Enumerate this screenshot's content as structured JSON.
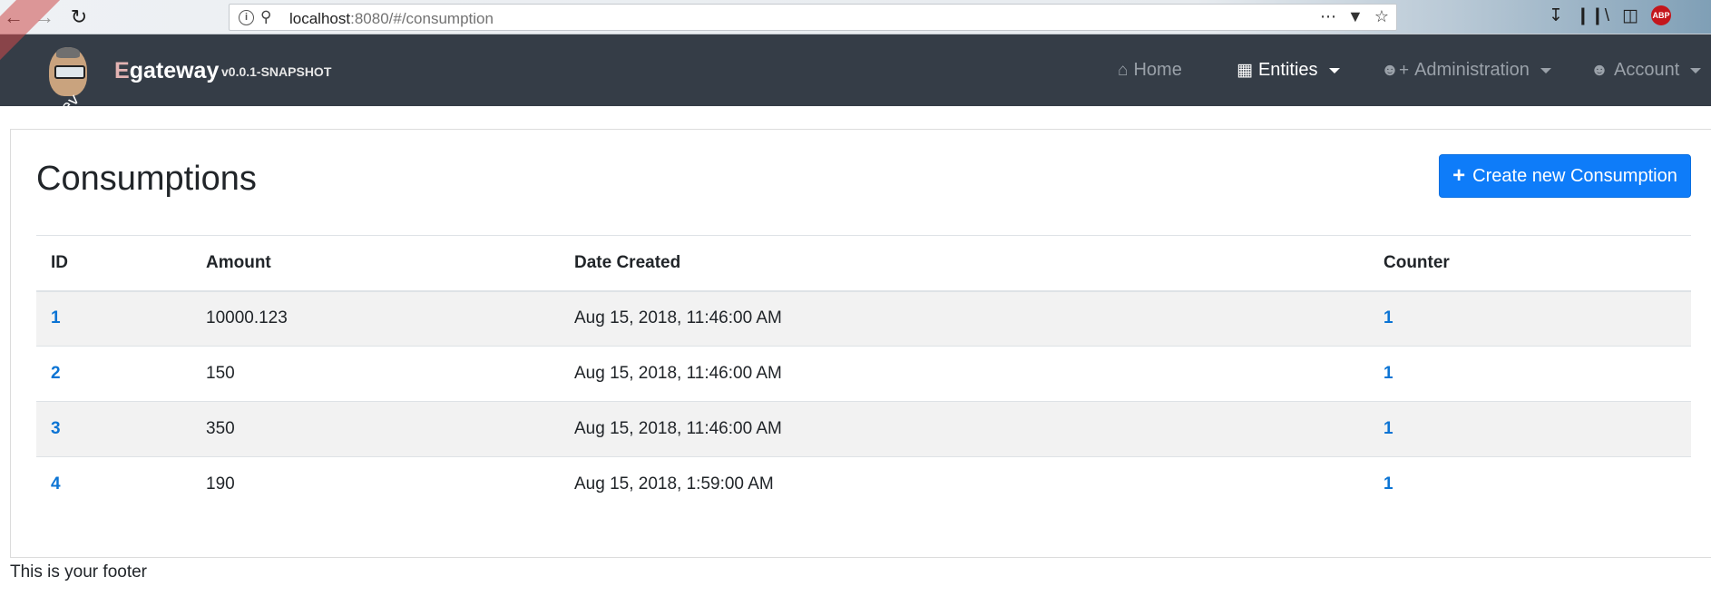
{
  "browser": {
    "url_host": "localhost",
    "url_rest": ":8080/#/consumption",
    "abp_label": "ABP"
  },
  "app": {
    "ribbon": "dev",
    "brand_first": "E",
    "brand_rest": "gateway",
    "version": "v0.0.1-SNAPSHOT"
  },
  "nav": {
    "home": "Home",
    "entities": "Entities",
    "administration": "Administration",
    "account": "Account"
  },
  "page": {
    "title": "Consumptions",
    "create_button": "Create new Consumption"
  },
  "table": {
    "headers": [
      "ID",
      "Amount",
      "Date Created",
      "Counter"
    ],
    "rows": [
      {
        "id": "1",
        "amount": "10000.123",
        "date": "Aug 15, 2018, 11:46:00 AM",
        "counter": "1"
      },
      {
        "id": "2",
        "amount": "150",
        "date": "Aug 15, 2018, 11:46:00 AM",
        "counter": "1"
      },
      {
        "id": "3",
        "amount": "350",
        "date": "Aug 15, 2018, 11:46:00 AM",
        "counter": "1"
      },
      {
        "id": "4",
        "amount": "190",
        "date": "Aug 15, 2018, 1:59:00 AM",
        "counter": "1"
      }
    ]
  },
  "footer": "This is your footer",
  "colors": {
    "navbar": "#353d47",
    "primary": "#0e7cf9",
    "link": "#0c74d4",
    "ribbon": "#cd4b4b"
  },
  "icons": [
    "back-icon",
    "forward-icon",
    "reload-icon",
    "info-icon",
    "key-icon",
    "more-icon",
    "pocket-icon",
    "star-icon",
    "download-icon",
    "library-icon",
    "sidebar-icon",
    "abp-icon",
    "home-icon",
    "table-icon",
    "user-plus-icon",
    "user-icon",
    "plus-icon"
  ]
}
